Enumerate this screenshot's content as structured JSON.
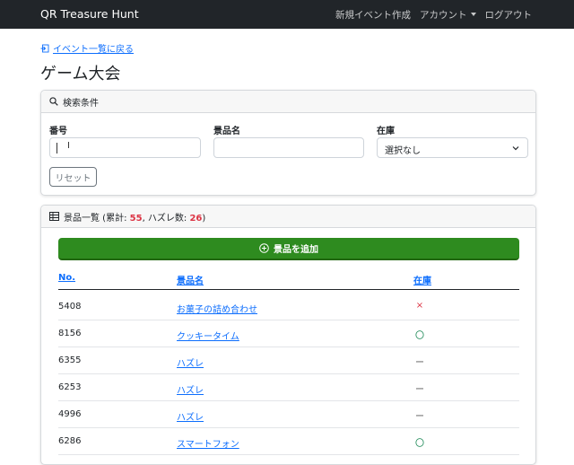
{
  "navbar": {
    "brand": "QR Treasure Hunt",
    "links": [
      "新規イベント作成",
      "アカウント",
      "ログアウト"
    ]
  },
  "back_link": "イベント一覧に戻る",
  "page_title": "ゲーム大会",
  "search": {
    "header": "検索条件",
    "number_label": "番号",
    "number_value": "",
    "prize_label": "景品名",
    "prize_value": "",
    "stock_label": "在庫",
    "stock_selected": "選択なし",
    "reset_label": "リセット"
  },
  "list": {
    "header_prefix": "景品一覧 (累計: ",
    "total": "55",
    "header_mid": ", ハズレ数: ",
    "miss": "26",
    "header_suffix": ")",
    "add_button": "景品を追加",
    "columns": [
      "No.",
      "景品名",
      "在庫"
    ],
    "rows": [
      {
        "no": "5408",
        "name": "お菓子の詰め合わせ",
        "stock": "×"
      },
      {
        "no": "8156",
        "name": "クッキータイム",
        "stock": "〇"
      },
      {
        "no": "6355",
        "name": "ハズレ",
        "stock": "ー"
      },
      {
        "no": "6253",
        "name": "ハズレ",
        "stock": "ー"
      },
      {
        "no": "4996",
        "name": "ハズレ",
        "stock": "ー"
      },
      {
        "no": "6286",
        "name": "スマートフォン",
        "stock": "〇"
      }
    ]
  },
  "colors": {
    "navbar": "#212529",
    "link": "#0d6efd",
    "accent_green": "#2e8b1f",
    "danger": "#dc3545"
  }
}
